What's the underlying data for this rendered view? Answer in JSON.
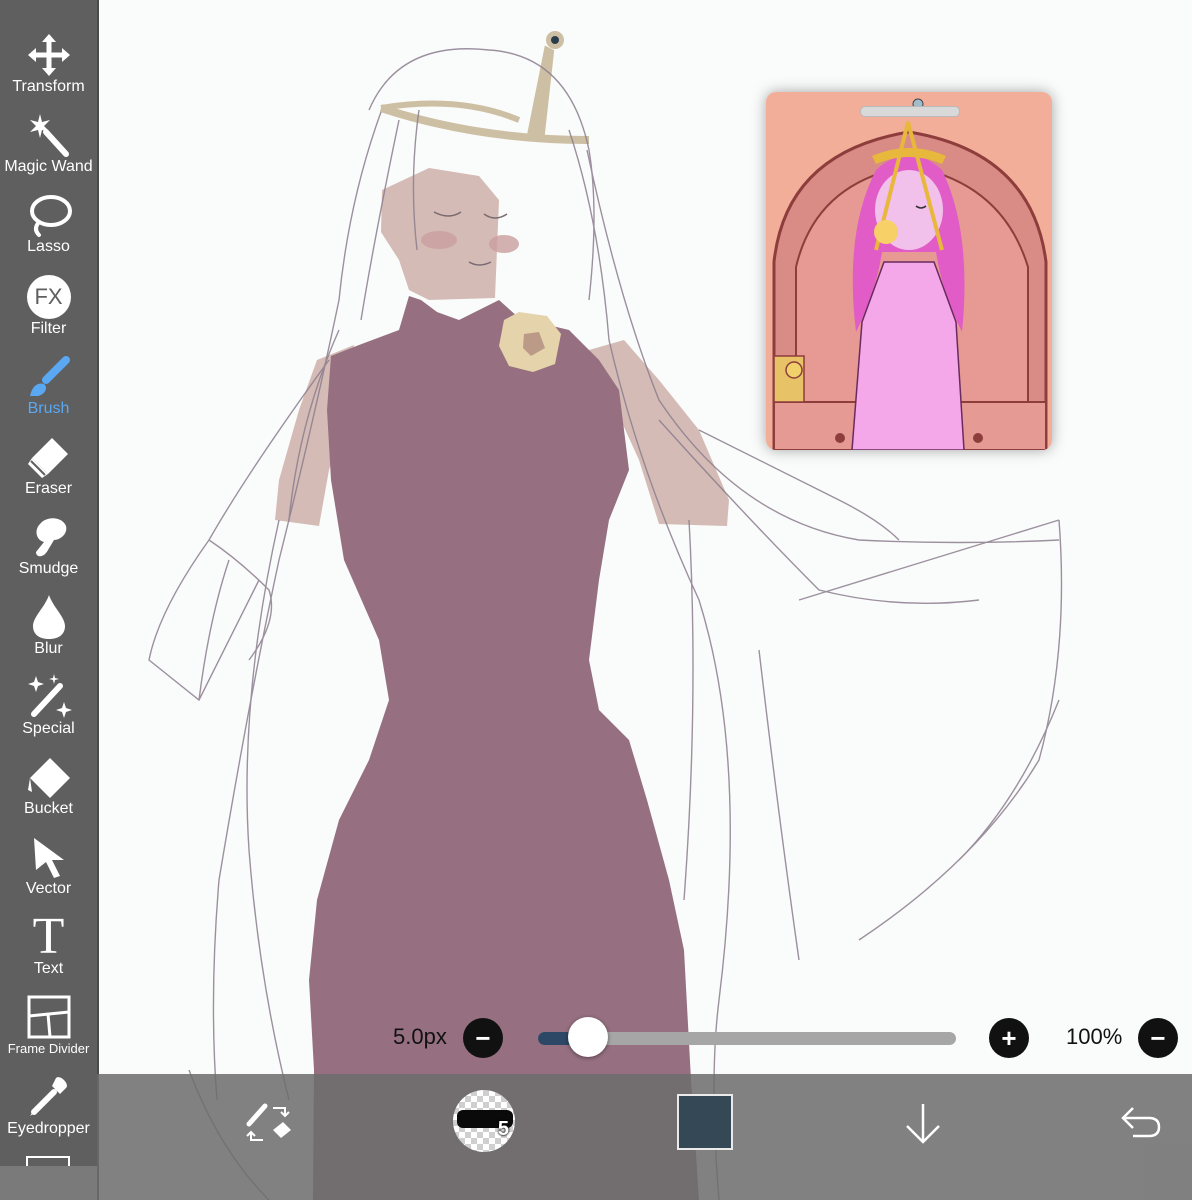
{
  "toolbar": {
    "tools": [
      {
        "label": "Transform",
        "icon": "transform-icon"
      },
      {
        "label": "Magic Wand",
        "icon": "magic-wand-icon"
      },
      {
        "label": "Lasso",
        "icon": "lasso-icon"
      },
      {
        "label": "Filter",
        "icon": "fx-filter-icon",
        "icon_text": "FX"
      },
      {
        "label": "Brush",
        "icon": "brush-icon",
        "active": true
      },
      {
        "label": "Eraser",
        "icon": "eraser-icon"
      },
      {
        "label": "Smudge",
        "icon": "smudge-icon"
      },
      {
        "label": "Blur",
        "icon": "blur-drop-icon"
      },
      {
        "label": "Special",
        "icon": "special-sparkle-icon"
      },
      {
        "label": "Bucket",
        "icon": "bucket-icon"
      },
      {
        "label": "Vector",
        "icon": "vector-arrow-icon"
      },
      {
        "label": "Text",
        "icon": "text-icon",
        "icon_text": "T"
      },
      {
        "label": "Frame Divider",
        "icon": "frame-divider-icon"
      },
      {
        "label": "Eyedropper",
        "icon": "eyedropper-icon"
      }
    ]
  },
  "brush": {
    "size_label": "5.0px",
    "size_fraction": 0.12,
    "decrease_glyph": "−",
    "increase_glyph": "+",
    "opacity_label": "100%",
    "opacity_decrease_glyph": "−"
  },
  "bottom_bar": {
    "brush_preview_number": "5",
    "current_color": "#344955"
  },
  "colors": {
    "toolbar_bg": "#5f5f5f",
    "active_tool": "#5aa7f2",
    "dress": "#967080",
    "skin": "#d4bbb6",
    "reference_bg": "#f2ae98"
  }
}
